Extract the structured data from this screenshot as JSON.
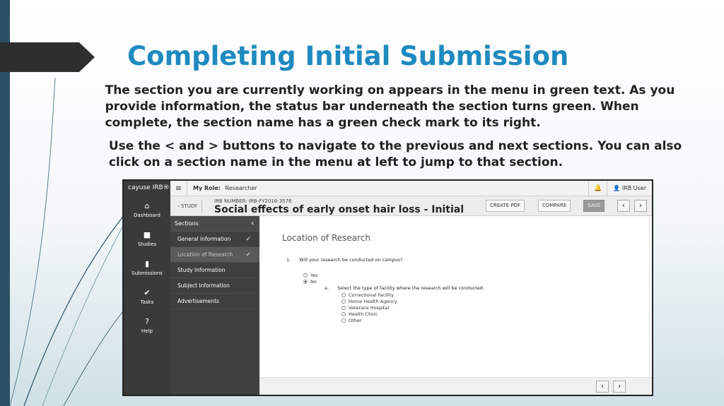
{
  "slide": {
    "title": "Completing Initial Submission",
    "bullet_glyph": "",
    "bullets": [
      "The section you are currently working on appears in the menu in green text. As you provide information, the status bar underneath the section turns green. When complete, the section name has a green check mark to its right.",
      "Use the < and > buttons to navigate to the previous and next sections. You can also click on a section name in the menu at left to jump to that section."
    ]
  },
  "app": {
    "brand": "cayuse IRB®",
    "rail": [
      {
        "icon": "home-icon",
        "glyph": "⌂",
        "label": "Dashboard"
      },
      {
        "icon": "folder-icon",
        "glyph": "■",
        "label": "Studies"
      },
      {
        "icon": "document-icon",
        "glyph": "▮",
        "label": "Submissions"
      },
      {
        "icon": "check-icon",
        "glyph": "✔",
        "label": "Tasks"
      },
      {
        "icon": "help-icon",
        "glyph": "?",
        "label": "Help"
      }
    ],
    "topbar": {
      "menu_glyph": "≡",
      "role_label": "My Role:",
      "role_value": "Researcher",
      "bell_glyph": "🔔",
      "user_label": "👤 IRB User"
    },
    "study": {
      "back_label": "‹ STUDY",
      "irb_number": "IRB NUMBER: IRB-FY2016-3576",
      "title": "Social effects of early onset hair loss - Initial",
      "create_pdf": "CREATE PDF",
      "compare": "COMPARE",
      "save": "SAVE",
      "prev": "‹",
      "next": "›"
    },
    "sections": {
      "header": "Sections",
      "collapse_glyph": "‹",
      "items": [
        {
          "label": "General Information",
          "check": "✔"
        },
        {
          "label": "Location of Research",
          "check": "✔"
        },
        {
          "label": "Study Information",
          "check": ""
        },
        {
          "label": "Subject Information",
          "check": ""
        },
        {
          "label": "Advertisements",
          "check": ""
        }
      ]
    },
    "form": {
      "title": "Location of Research",
      "q1_number": "1.",
      "q1_text": "Will your research be conducted on campus?",
      "q1_options": [
        "Yes",
        "No"
      ],
      "q1_selected": "No",
      "sub_letter": "a.",
      "sub_text": "Select the type of facility where the research will be conducted.",
      "facility_options": [
        "Correctional Facility",
        "Home Health Agency",
        "Veterans Hospital",
        "Health Clinic",
        "Other"
      ]
    },
    "footer": {
      "prev": "‹",
      "next": "›"
    }
  },
  "colors": {
    "title_blue": "#1f8ac0",
    "rail_dark": "#3a3a3a",
    "sidebar_dark": "#3f3f3f",
    "accent_bar": "#2b4f63"
  }
}
